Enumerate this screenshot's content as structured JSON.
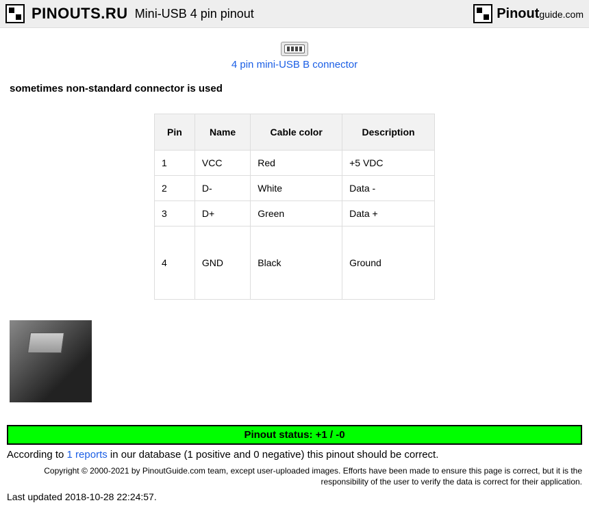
{
  "header": {
    "logo_text": "PINOUTS.RU",
    "page_title": "Mini-USB 4 pin pinout",
    "guide_logo_main": "Pinout",
    "guide_logo_sub": "guide.com"
  },
  "connector": {
    "link_text": "4 pin mini-USB B connector"
  },
  "subtitle": "sometimes non-standard connector is used",
  "table": {
    "headers": {
      "pin": "Pin",
      "name": "Name",
      "color": "Cable color",
      "description": "Description"
    },
    "rows": [
      {
        "pin": "1",
        "name": "VCC",
        "color": "Red",
        "description": "+5 VDC"
      },
      {
        "pin": "2",
        "name": "D-",
        "color": "White",
        "description": "Data -"
      },
      {
        "pin": "3",
        "name": "D+",
        "color": "Green",
        "description": "Data +"
      },
      {
        "pin": "4",
        "name": "GND",
        "color": "Black",
        "description": "Ground"
      }
    ]
  },
  "status": {
    "bar_text": "Pinout status: +1 / -0",
    "prefix": "According to ",
    "reports_link": "1 reports",
    "suffix": " in our database (1 positive and 0 negative) this pinout should be correct."
  },
  "footer": {
    "copyright": "Copyright © 2000-2021 by PinoutGuide.com team, except user-uploaded images. Efforts have been made to ensure this page is correct, but it is the responsibility of the user to verify the data is correct for their application.",
    "updated": "Last updated 2018-10-28 22:24:57."
  }
}
